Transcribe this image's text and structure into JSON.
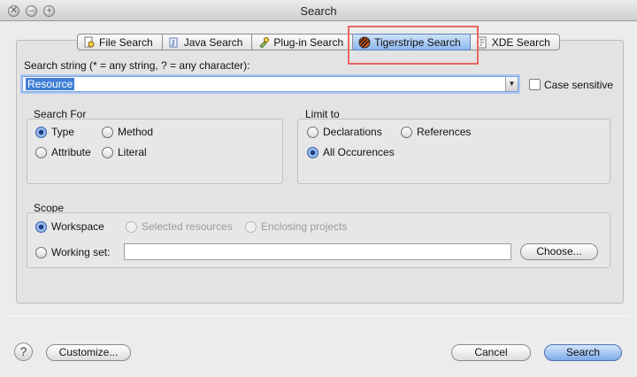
{
  "window": {
    "title": "Search"
  },
  "tabs": [
    {
      "label": "File Search",
      "icon": "file-search-icon"
    },
    {
      "label": "Java Search",
      "icon": "java-search-icon"
    },
    {
      "label": "Plug-in Search",
      "icon": "plugin-search-icon"
    },
    {
      "label": "Tigerstripe Search",
      "icon": "tigerstripe-icon",
      "active": true
    },
    {
      "label": "XDE Search",
      "icon": "xde-search-icon"
    }
  ],
  "search": {
    "label": "Search string (* = any string, ? = any character):",
    "value": "Resource",
    "case_sensitive_label": "Case sensitive",
    "case_sensitive": false
  },
  "search_for": {
    "title": "Search For",
    "options": [
      {
        "label": "Type",
        "selected": true
      },
      {
        "label": "Method",
        "selected": false
      },
      {
        "label": "Attribute",
        "selected": false
      },
      {
        "label": "Literal",
        "selected": false
      }
    ]
  },
  "limit_to": {
    "title": "Limit to",
    "options": [
      {
        "label": "Declarations",
        "selected": false
      },
      {
        "label": "References",
        "selected": false
      },
      {
        "label": "All Occurences",
        "selected": true
      }
    ]
  },
  "scope": {
    "title": "Scope",
    "options": [
      {
        "label": "Workspace",
        "selected": true,
        "enabled": true
      },
      {
        "label": "Selected resources",
        "selected": false,
        "enabled": false
      },
      {
        "label": "Enclosing projects",
        "selected": false,
        "enabled": false
      },
      {
        "label": "Working set:",
        "selected": false,
        "enabled": true
      }
    ],
    "working_set_value": "",
    "choose_label": "Choose..."
  },
  "footer": {
    "customize_label": "Customize...",
    "cancel_label": "Cancel",
    "search_label": "Search"
  },
  "colors": {
    "accent": "#3f7fd6",
    "highlight": "#e96565"
  }
}
